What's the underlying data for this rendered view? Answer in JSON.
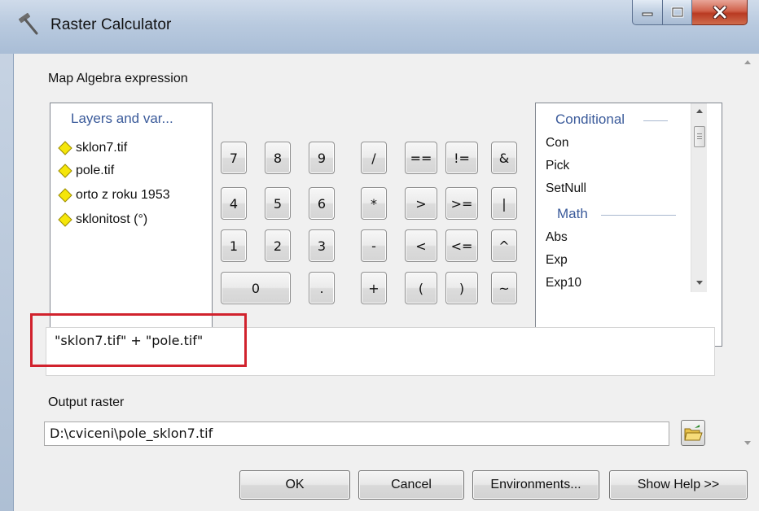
{
  "window": {
    "title": "Raster Calculator"
  },
  "map_algebra": {
    "label": "Map Algebra expression",
    "layers_header": "Layers and var...",
    "layers": [
      "sklon7.tif",
      "pole.tif",
      "orto z roku 1953",
      "sklonitost (°)"
    ]
  },
  "calculator": {
    "rows": [
      [
        "7",
        "8",
        "9",
        "/",
        "==",
        "!=",
        "&"
      ],
      [
        "4",
        "5",
        "6",
        "*",
        ">",
        ">=",
        "|"
      ],
      [
        "1",
        "2",
        "3",
        "-",
        "<",
        "<=",
        "^"
      ],
      [
        "0",
        ".",
        "+",
        "(",
        ")",
        "~"
      ]
    ]
  },
  "functions": {
    "groups": [
      {
        "header": "Conditional",
        "items": [
          "Con",
          "Pick",
          "SetNull"
        ]
      },
      {
        "header": "Math",
        "items": [
          "Abs",
          "Exp",
          "Exp10"
        ]
      }
    ]
  },
  "expression": {
    "value": "\"sklon7.tif\" + \"pole.tif\""
  },
  "output": {
    "label": "Output raster",
    "value": "D:\\cviceni\\pole_sklon7.tif"
  },
  "buttons": {
    "ok": "OK",
    "cancel": "Cancel",
    "environments": "Environments...",
    "show_help": "Show Help >>"
  },
  "colors": {
    "layer_diamond": "#f5e60a",
    "highlight_box": "#d1222d",
    "header_blue": "#3a5a9a"
  }
}
